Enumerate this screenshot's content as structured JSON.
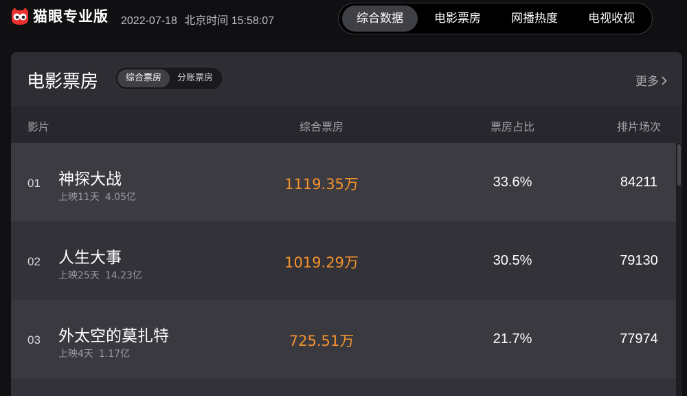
{
  "app": {
    "brand": "猫眼专业版",
    "date": "2022-07-18",
    "time_label": "北京时间",
    "time": "15:58:07"
  },
  "nav": {
    "tabs": [
      {
        "label": "综合数据",
        "active": true
      },
      {
        "label": "电影票房",
        "active": false
      },
      {
        "label": "网播热度",
        "active": false
      },
      {
        "label": "电视收视",
        "active": false
      }
    ]
  },
  "panel": {
    "title": "电影票房",
    "toggle": [
      {
        "label": "综合票房",
        "active": true
      },
      {
        "label": "分账票房",
        "active": false
      }
    ],
    "more_label": "更多"
  },
  "table": {
    "columns": [
      "影片",
      "综合票房",
      "票房占比",
      "排片场次"
    ],
    "rows": [
      {
        "rank": "01",
        "title": "神探大战",
        "days": "上映11天",
        "total": "4.05亿",
        "box_office": "1119.35万",
        "share": "33.6%",
        "shows": "84211"
      },
      {
        "rank": "02",
        "title": "人生大事",
        "days": "上映25天",
        "total": "14.23亿",
        "box_office": "1019.29万",
        "share": "30.5%",
        "shows": "79130"
      },
      {
        "rank": "03",
        "title": "外太空的莫扎特",
        "days": "上映4天",
        "total": "1.17亿",
        "box_office": "725.51万",
        "share": "21.7%",
        "shows": "77974"
      }
    ]
  },
  "colors": {
    "accent_orange": "#f5932c",
    "logo_red": "#e8322f",
    "background": "#111114",
    "panel": "#242428"
  },
  "icons": {
    "logo": "cat-eye-logo-icon",
    "more": "chevron-right-icon"
  }
}
